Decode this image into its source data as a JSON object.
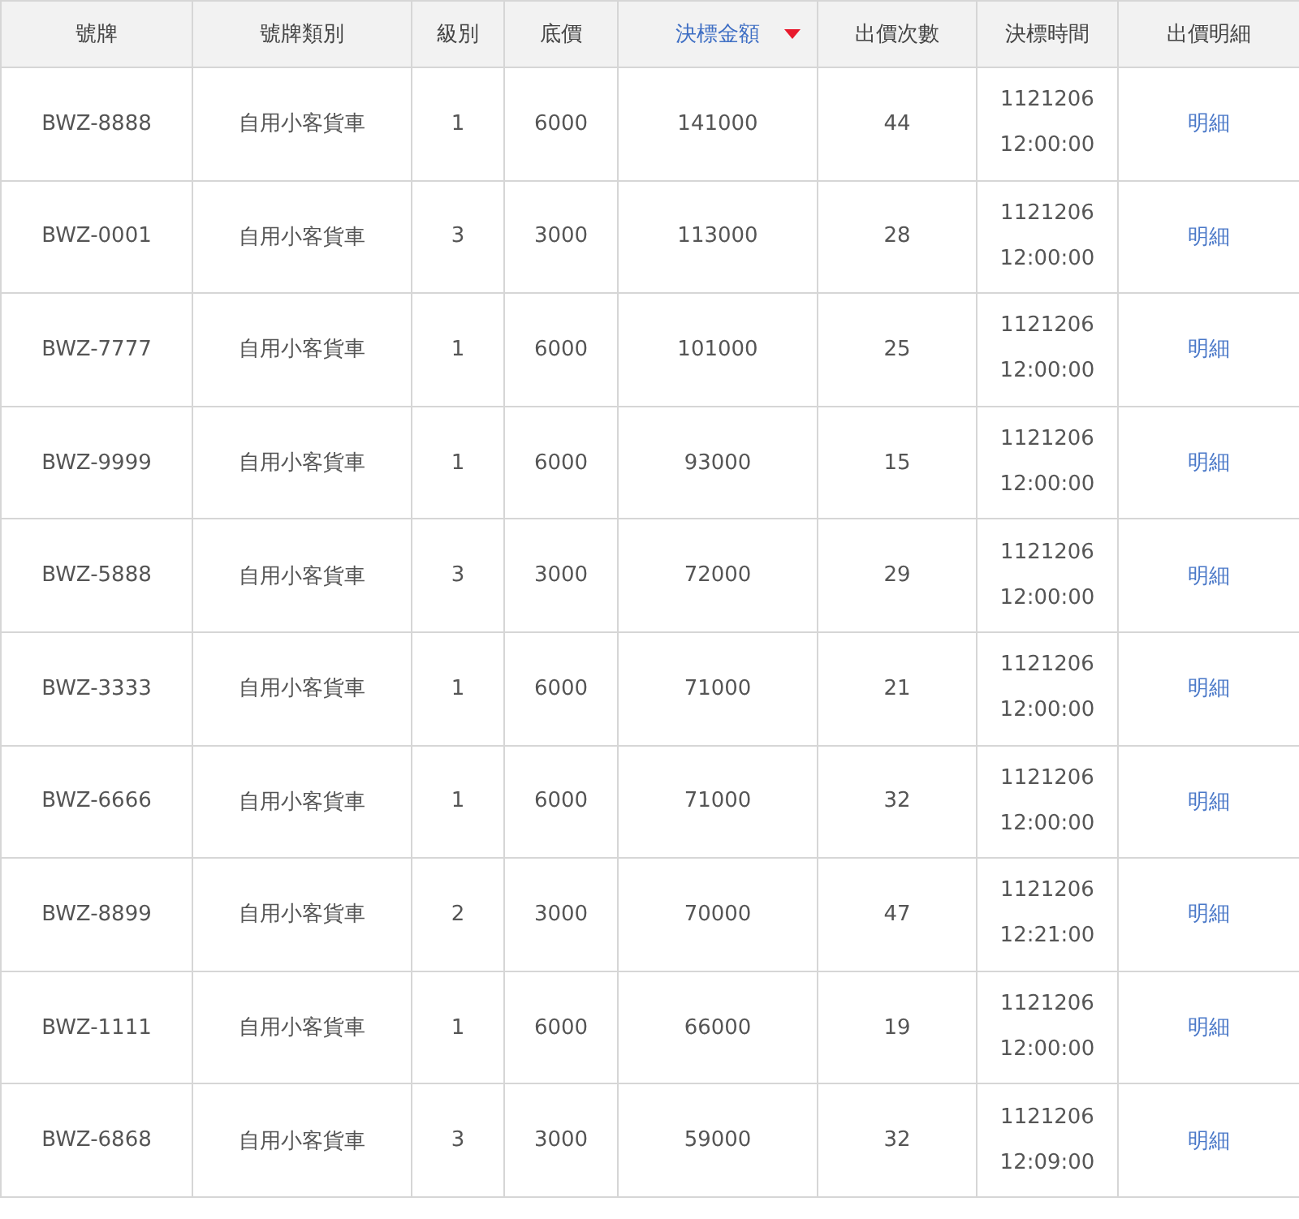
{
  "table": {
    "columns": [
      {
        "label": "號牌",
        "sorted": false
      },
      {
        "label": "號牌類別",
        "sorted": false
      },
      {
        "label": "級別",
        "sorted": false
      },
      {
        "label": "底價",
        "sorted": false
      },
      {
        "label": "決標金額",
        "sorted": true
      },
      {
        "label": "出價次數",
        "sorted": false
      },
      {
        "label": "決標時間",
        "sorted": false
      },
      {
        "label": "出價明細",
        "sorted": false
      }
    ],
    "rows": [
      {
        "plate": "BWZ-8888",
        "category": "自用小客貨車",
        "level": "1",
        "base_price": "6000",
        "winning_bid": "141000",
        "bids": "44",
        "date": "1121206",
        "time": "12:00:00",
        "detail": "明細"
      },
      {
        "plate": "BWZ-0001",
        "category": "自用小客貨車",
        "level": "3",
        "base_price": "3000",
        "winning_bid": "113000",
        "bids": "28",
        "date": "1121206",
        "time": "12:00:00",
        "detail": "明細"
      },
      {
        "plate": "BWZ-7777",
        "category": "自用小客貨車",
        "level": "1",
        "base_price": "6000",
        "winning_bid": "101000",
        "bids": "25",
        "date": "1121206",
        "time": "12:00:00",
        "detail": "明細"
      },
      {
        "plate": "BWZ-9999",
        "category": "自用小客貨車",
        "level": "1",
        "base_price": "6000",
        "winning_bid": "93000",
        "bids": "15",
        "date": "1121206",
        "time": "12:00:00",
        "detail": "明細"
      },
      {
        "plate": "BWZ-5888",
        "category": "自用小客貨車",
        "level": "3",
        "base_price": "3000",
        "winning_bid": "72000",
        "bids": "29",
        "date": "1121206",
        "time": "12:00:00",
        "detail": "明細"
      },
      {
        "plate": "BWZ-3333",
        "category": "自用小客貨車",
        "level": "1",
        "base_price": "6000",
        "winning_bid": "71000",
        "bids": "21",
        "date": "1121206",
        "time": "12:00:00",
        "detail": "明細"
      },
      {
        "plate": "BWZ-6666",
        "category": "自用小客貨車",
        "level": "1",
        "base_price": "6000",
        "winning_bid": "71000",
        "bids": "32",
        "date": "1121206",
        "time": "12:00:00",
        "detail": "明細"
      },
      {
        "plate": "BWZ-8899",
        "category": "自用小客貨車",
        "level": "2",
        "base_price": "3000",
        "winning_bid": "70000",
        "bids": "47",
        "date": "1121206",
        "time": "12:21:00",
        "detail": "明細"
      },
      {
        "plate": "BWZ-1111",
        "category": "自用小客貨車",
        "level": "1",
        "base_price": "6000",
        "winning_bid": "66000",
        "bids": "19",
        "date": "1121206",
        "time": "12:00:00",
        "detail": "明細"
      },
      {
        "plate": "BWZ-6868",
        "category": "自用小客貨車",
        "level": "3",
        "base_price": "3000",
        "winning_bid": "59000",
        "bids": "32",
        "date": "1121206",
        "time": "12:09:00",
        "detail": "明細"
      }
    ]
  }
}
